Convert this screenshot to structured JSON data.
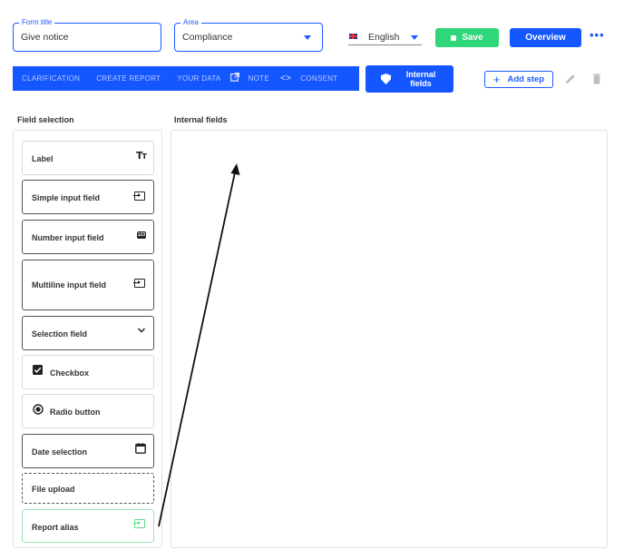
{
  "form": {
    "title_legend": "Form title",
    "title_value": "Give notice",
    "area_legend": "Area",
    "area_value": "Compliance"
  },
  "language": {
    "selected": "English",
    "flag_icon": "uk-flag-icon"
  },
  "toolbar": {
    "save_label": "Save",
    "overview_label": "Overview",
    "more_label": "•••",
    "internal_fields_label": "Internal fields",
    "add_step_label": "Add step"
  },
  "nav": {
    "tabs": [
      {
        "label": "CLARIFICATION"
      },
      {
        "label": "CREATE REPORT"
      },
      {
        "label": "YOUR DATA"
      },
      {
        "label": "NOTE"
      },
      {
        "label": "CONSENT"
      }
    ]
  },
  "sections": {
    "field_selection": "Field selection",
    "internal_fields": "Internal fields"
  },
  "fields": [
    {
      "label": "Label",
      "icon": "text-size-icon"
    },
    {
      "label": "Simple input field",
      "icon": "input-icon"
    },
    {
      "label": "Number input field",
      "icon": "number-123-icon"
    },
    {
      "label": "Multiline input field",
      "icon": "input-icon"
    },
    {
      "label": "Selection field",
      "icon": "chevron-down-icon"
    },
    {
      "label": "Checkbox",
      "icon": "checkbox-icon"
    },
    {
      "label": "Radio button",
      "icon": "radio-icon"
    },
    {
      "label": "Date selection",
      "icon": "calendar-icon"
    },
    {
      "label": "File upload",
      "icon": ""
    },
    {
      "label": "Report alias",
      "icon": "input-icon"
    }
  ],
  "colors": {
    "primary": "#1557ff",
    "save": "#2fd67a",
    "green_border": "#9be6b5"
  }
}
